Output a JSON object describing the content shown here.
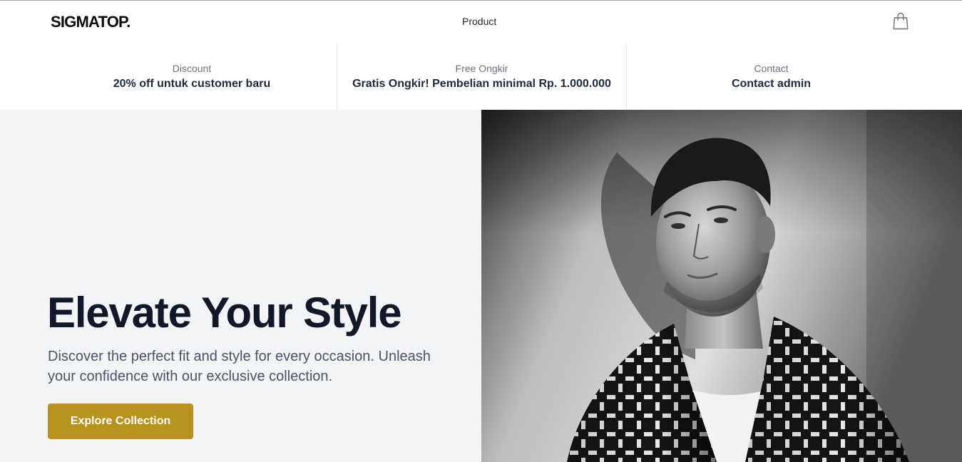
{
  "brand": {
    "logo_text": "SIGMATOP."
  },
  "nav": {
    "product_label": "Product",
    "cart_icon": "shopping-bag-icon"
  },
  "info_bar": [
    {
      "label": "Discount",
      "value": "20% off untuk customer baru"
    },
    {
      "label": "Free Ongkir",
      "value": "Gratis Ongkir! Pembelian minimal Rp. 1.000.000"
    },
    {
      "label": "Contact",
      "value": "Contact admin"
    }
  ],
  "hero": {
    "title": "Elevate Your Style",
    "subtitle": "Discover the perfect fit and style for every occasion. Unleash your confidence with our exclusive collection.",
    "cta_label": "Explore Collection",
    "image_subject": "black-and-white portrait of a man in a patterned shirt against a textured wall"
  },
  "colors": {
    "accent": "#b8921f",
    "hero_bg": "#f3f4f6",
    "text_dark": "#111827",
    "text_muted": "#6b7280"
  }
}
